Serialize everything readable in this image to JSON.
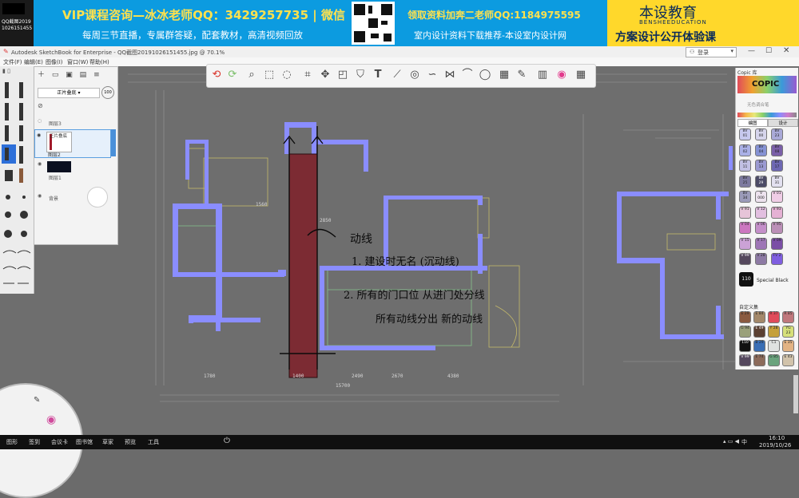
{
  "banner": {
    "qq_label": "QQ截图2019",
    "qq_id": "1026151455",
    "vip_line": "VIP课程咨询—冰冰老师QQ：3429257735 | 微信",
    "sub_line": "每周三节直播，专属群答疑，配套教材，高清视频回放",
    "resource_line": "领取资料加奔二老师QQ:1184975595",
    "resource_sub": "室内设计资料下载推荐-本设室内设计网",
    "brand_cn": "本设教育",
    "brand_en": "BENSHEEDUCATION",
    "brand_slogan": "方案设计公开体验课"
  },
  "window": {
    "title": "Autodesk SketchBook for Enterprise - QQ截图20191026151455.jpg @ 70.1%",
    "login": "登录",
    "menu": [
      "文件(F)",
      "编辑(E)",
      "图像(I)",
      "窗口(W)",
      "帮助(H)"
    ]
  },
  "toolbar": {
    "icons": [
      "undo-icon",
      "redo-icon",
      "zoom-icon",
      "select-icon",
      "lasso-icon",
      "crop-icon",
      "transform-icon",
      "distort-icon",
      "fill-icon",
      "text-icon",
      "ruler-icon",
      "ellipse-icon",
      "french-curve-icon",
      "symmetry-icon",
      "curve-icon",
      "shape-icon",
      "copic-icon",
      "brush-library-icon",
      "color-wheel-icon",
      "grid-icon"
    ]
  },
  "layers": {
    "blend_mode": "正片叠底",
    "opacity": "100",
    "items": [
      {
        "name": "图层3"
      },
      {
        "name": "图层2",
        "mode": "正片叠底"
      },
      {
        "name": "图层1"
      },
      {
        "name": "背景"
      }
    ]
  },
  "copic": {
    "header": "Copic 库",
    "logo": "COPIC",
    "hint": "无色调合笔",
    "tabs": [
      "编图",
      "设计"
    ],
    "swatches": [
      {
        "code": "BV 01",
        "color": "#c7c9ee"
      },
      {
        "code": "BV 00",
        "color": "#d6d5ec"
      },
      {
        "code": "BV 23",
        "color": "#a9a9d8"
      },
      {
        "code": "BV 02",
        "color": "#aab0e6"
      },
      {
        "code": "BV 04",
        "color": "#8592d4"
      },
      {
        "code": "BV 08",
        "color": "#7a5fa8"
      },
      {
        "code": "BV 11",
        "color": "#c2c0e4"
      },
      {
        "code": "BV 13",
        "color": "#9b9ad2"
      },
      {
        "code": "BV 17",
        "color": "#6e68b3"
      },
      {
        "code": "BV 25",
        "color": "#7d7aa0"
      },
      {
        "code": "BV 29",
        "color": "#4c4b66"
      },
      {
        "code": "BV 31",
        "color": "#e3e1f0"
      },
      {
        "code": "BV 34",
        "color": "#9b9bb9"
      },
      {
        "code": "V 000",
        "color": "#ede3ee"
      },
      {
        "code": "V 01",
        "color": "#f0cde6"
      },
      {
        "code": "V 91",
        "color": "#e6c4d8"
      },
      {
        "code": "V 12",
        "color": "#e2bfe0"
      },
      {
        "code": "V 93",
        "color": "#e5b1d4"
      },
      {
        "code": "V 04",
        "color": "#cc77c0"
      },
      {
        "code": "V 06",
        "color": "#c48fc9"
      },
      {
        "code": "V 95",
        "color": "#bb8fb7"
      },
      {
        "code": "V 15",
        "color": "#cba2d6"
      },
      {
        "code": "V 17",
        "color": "#9e76b6"
      },
      {
        "code": "V 09",
        "color": "#7b4fa6"
      },
      {
        "code": "V 99",
        "color": "#55485e"
      },
      {
        "code": "V 28",
        "color": "#8d7aa4"
      },
      {
        "code": "FV 2",
        "color": "#7f5ee0"
      }
    ],
    "selected_code": "110",
    "selected_name": "Special Black",
    "recent_title": "自定义集",
    "recent": [
      {
        "code": "E 29",
        "color": "#8a5a40"
      },
      {
        "code": "E 84",
        "color": "#a3886a"
      },
      {
        "code": "R 37",
        "color": "#e04b5a"
      },
      {
        "code": "R 85",
        "color": "#c0787d"
      },
      {
        "code": "G 94",
        "color": "#9aa07a"
      },
      {
        "code": "E 49",
        "color": "#5b4032"
      },
      {
        "code": "Y 28",
        "color": "#c5a03a"
      },
      {
        "code": "YG 23",
        "color": "#d6e07a"
      },
      {
        "code": "110",
        "color": "#111111"
      },
      {
        "code": "B 29",
        "color": "#3a6eb5"
      },
      {
        "code": "C1",
        "color": "#e0e2e1"
      },
      {
        "code": "E 35",
        "color": "#e2b384"
      },
      {
        "code": "V 99",
        "color": "#55485e"
      },
      {
        "code": "E 74",
        "color": "#8c6b5b"
      },
      {
        "code": "G 85",
        "color": "#6aa37d"
      },
      {
        "code": "E 43",
        "color": "#d1c3ab"
      }
    ]
  },
  "drawing": {
    "annotations": [
      "动线",
      "1. 建设时无名 (沉动线)",
      "2. 所有的门口位 从进门处分线",
      "所有动线分出 新的动线"
    ],
    "dimensions": [
      "1560",
      "2850",
      "2670",
      "4380",
      "1780",
      "2490",
      "15700",
      "1400"
    ]
  },
  "taskbar": {
    "items": [
      "图形",
      "签到",
      "会议卡",
      "图书馆",
      "草家",
      "预览",
      "工具"
    ],
    "time": "16:10",
    "date": "2019/10/26",
    "ime": "中"
  },
  "colors": {
    "wall": "#8a8dff",
    "accent_red": "#7c2b33",
    "banner_bg": "#0c9be0",
    "banner_yellow": "#ffd82b"
  }
}
